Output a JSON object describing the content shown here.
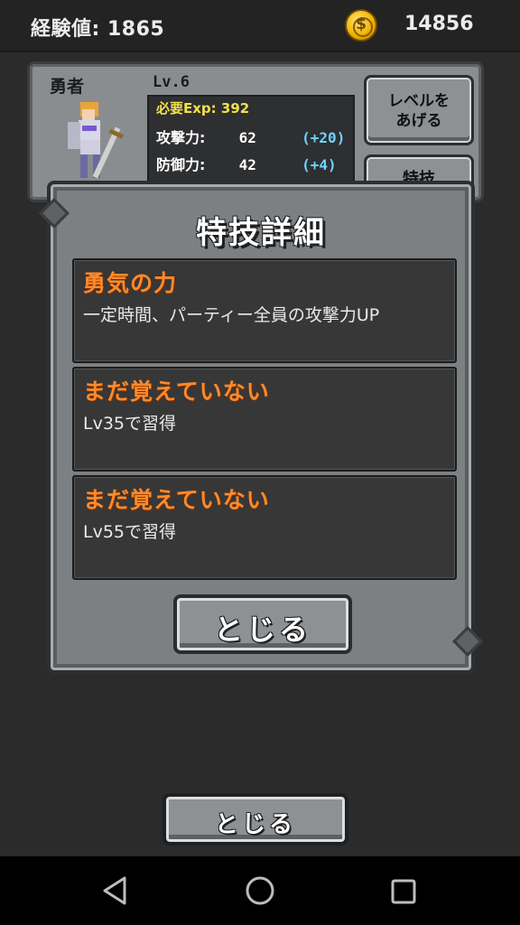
{
  "status": {
    "exp_label": "経験値: 1865",
    "gold": "14856",
    "coin_icon": "gold-coin-icon",
    "coin_glyph": "$"
  },
  "hero": {
    "name": "勇者",
    "level": "Lv.6",
    "required_exp": "必要Exp: 392",
    "stats": [
      {
        "label": "攻撃力:",
        "value": "62",
        "bonus": "(+20)"
      },
      {
        "label": "防御力:",
        "value": "42",
        "bonus": "(+4)"
      }
    ],
    "levelup_button": "レベルを\nあげる",
    "skill_button": "特技"
  },
  "modal": {
    "title": "特技詳細",
    "skills": [
      {
        "name": "勇気の力",
        "description": "一定時間、パーティー全員の攻撃力UP"
      },
      {
        "name": "まだ覚えていない",
        "description": "Lv35で習得"
      },
      {
        "name": "まだ覚えていない",
        "description": "Lv55で習得"
      }
    ],
    "close_button": "とじる"
  },
  "footer": {
    "close_button": "とじる"
  },
  "colors": {
    "skill_name": "#ff8a2a",
    "bonus": "#6fd3ff",
    "required_exp": "#f2e04b",
    "panel": "#7d8082"
  }
}
